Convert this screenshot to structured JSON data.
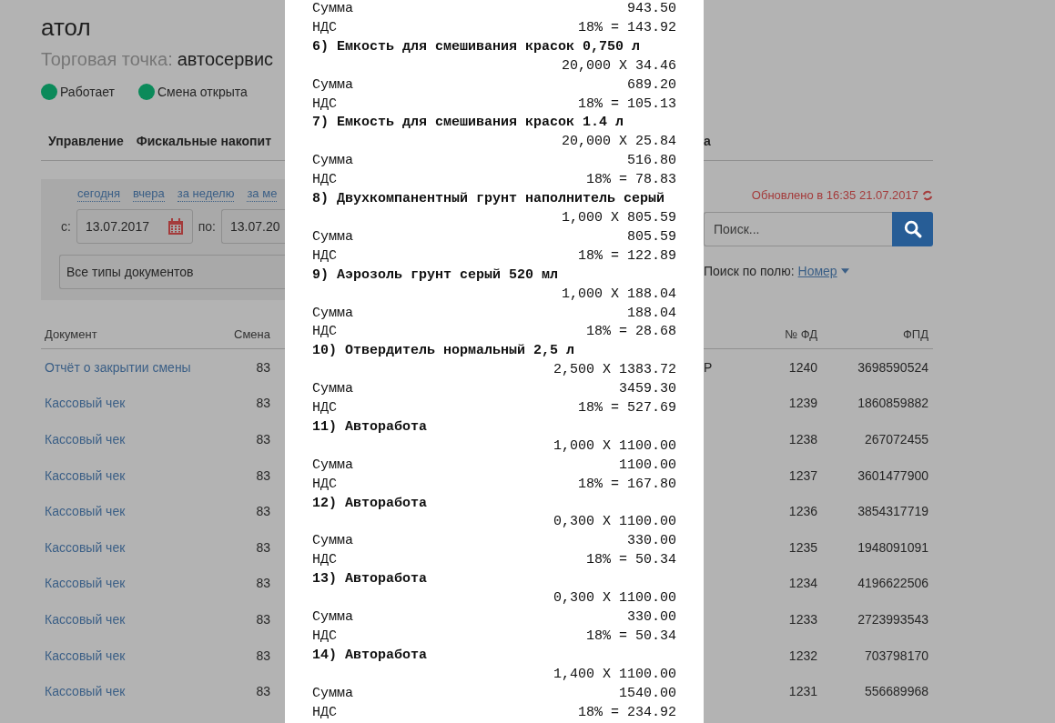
{
  "header": {
    "title": "атол",
    "subtitle_label": "Торговая точка:",
    "subtitle_value": "автосервис"
  },
  "statuses": [
    {
      "label": "Работает",
      "color": "#0b8a5a"
    },
    {
      "label": "Смена открыта",
      "color": "#0b8a5a"
    }
  ],
  "tabs": [
    "Управление",
    "Фискальные накопит",
    "а"
  ],
  "filters": {
    "quick_links": [
      "сегодня",
      "вчера",
      "за неделю",
      "за ме"
    ],
    "from_label": "с:",
    "from_value": "13.07.2017",
    "to_label": "по:",
    "to_value": "13.07.20",
    "doc_type": "Все типы документов"
  },
  "updated": "Обновлено в 16:35 21.07.2017",
  "search": {
    "placeholder": "Поиск...",
    "field_label": "Поиск по полю:",
    "field_value": "Номер"
  },
  "table": {
    "columns": [
      "Документ",
      "Смена",
      "№ ФД",
      "ФПД"
    ],
    "rows": [
      {
        "document": "Отчёт о закрытии смены",
        "shift": "83",
        "column_3": "Р",
        "fd": "1240",
        "fpd": "3698590524"
      },
      {
        "document": "Кассовый чек",
        "shift": "83",
        "fd": "1239",
        "fpd": "1860859882"
      },
      {
        "document": "Кассовый чек",
        "shift": "83",
        "fd": "1238",
        "fpd": "267072455"
      },
      {
        "document": "Кассовый чек",
        "shift": "83",
        "fd": "1237",
        "fpd": "3601477900"
      },
      {
        "document": "Кассовый чек",
        "shift": "83",
        "fd": "1236",
        "fpd": "3854317719"
      },
      {
        "document": "Кассовый чек",
        "shift": "83",
        "fd": "1235",
        "fpd": "1948091091"
      },
      {
        "document": "Кассовый чек",
        "shift": "83",
        "fd": "1234",
        "fpd": "4196622506"
      },
      {
        "document": "Кассовый чек",
        "shift": "83",
        "fd": "1233",
        "fpd": "2723993543"
      },
      {
        "document": "Кассовый чек",
        "shift": "83",
        "fd": "1232",
        "fpd": "703798170"
      },
      {
        "document": "Кассовый чек",
        "shift": "83",
        "fd": "1231",
        "fpd": "556689968"
      }
    ]
  },
  "receipt": [
    {
      "kind": "amount",
      "label": "Сумма",
      "value": "943.50"
    },
    {
      "kind": "amount",
      "label": "НДС",
      "value": "18% = 143.92"
    },
    {
      "kind": "item",
      "text": "6) Емкость для смешивания красок 0,750 л"
    },
    {
      "kind": "qty",
      "text": "20,000 X 34.46"
    },
    {
      "kind": "amount",
      "label": "Сумма",
      "value": "689.20"
    },
    {
      "kind": "amount",
      "label": "НДС",
      "value": "18% = 105.13"
    },
    {
      "kind": "item",
      "text": "7) Емкость для смешивания красок 1.4 л"
    },
    {
      "kind": "qty",
      "text": "20,000 X 25.84"
    },
    {
      "kind": "amount",
      "label": "Сумма",
      "value": "516.80"
    },
    {
      "kind": "amount",
      "label": "НДС",
      "value": "18% = 78.83"
    },
    {
      "kind": "item",
      "text": "8) Двухкомпанентный грунт наполнитель серый"
    },
    {
      "kind": "qty",
      "text": "1,000 X 805.59"
    },
    {
      "kind": "amount",
      "label": "Сумма",
      "value": "805.59"
    },
    {
      "kind": "amount",
      "label": "НДС",
      "value": "18% = 122.89"
    },
    {
      "kind": "item",
      "text": "9) Аэрозоль грунт серый 520 мл"
    },
    {
      "kind": "qty",
      "text": "1,000 X 188.04"
    },
    {
      "kind": "amount",
      "label": "Сумма",
      "value": "188.04"
    },
    {
      "kind": "amount",
      "label": "НДС",
      "value": "18% = 28.68"
    },
    {
      "kind": "item",
      "text": "10) Отвердитель нормальный 2,5 л"
    },
    {
      "kind": "qty",
      "text": "2,500 X 1383.72"
    },
    {
      "kind": "amount",
      "label": "Сумма",
      "value": "3459.30"
    },
    {
      "kind": "amount",
      "label": "НДС",
      "value": "18% = 527.69"
    },
    {
      "kind": "item",
      "text": "11) Авторабота"
    },
    {
      "kind": "qty",
      "text": "1,000 X 1100.00"
    },
    {
      "kind": "amount",
      "label": "Сумма",
      "value": "1100.00"
    },
    {
      "kind": "amount",
      "label": "НДС",
      "value": "18% = 167.80"
    },
    {
      "kind": "item",
      "text": "12) Авторабота"
    },
    {
      "kind": "qty",
      "text": "0,300 X 1100.00"
    },
    {
      "kind": "amount",
      "label": "Сумма",
      "value": "330.00"
    },
    {
      "kind": "amount",
      "label": "НДС",
      "value": "18% = 50.34"
    },
    {
      "kind": "item",
      "text": "13) Авторабота"
    },
    {
      "kind": "qty",
      "text": "0,300 X 1100.00"
    },
    {
      "kind": "amount",
      "label": "Сумма",
      "value": "330.00"
    },
    {
      "kind": "amount",
      "label": "НДС",
      "value": "18% = 50.34"
    },
    {
      "kind": "item",
      "text": "14) Авторабота"
    },
    {
      "kind": "qty",
      "text": "1,400 X 1100.00"
    },
    {
      "kind": "amount",
      "label": "Сумма",
      "value": "1540.00"
    },
    {
      "kind": "amount",
      "label": "НДС",
      "value": "18% = 234.92"
    }
  ]
}
